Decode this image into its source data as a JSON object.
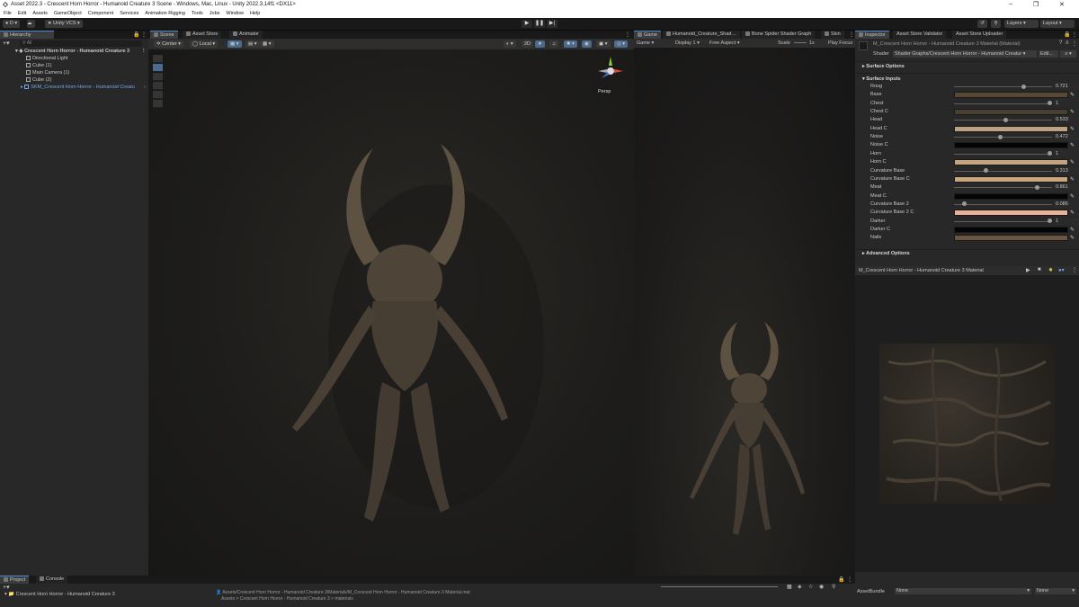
{
  "window": {
    "title": "Asset 2022.3 - Crescent Horn Horror - Humanoid Creature 3 Scene - Windows, Mac, Linux - Unity 2022.3.14f1 <DX11>"
  },
  "menu": [
    "File",
    "Edit",
    "Assets",
    "GameObject",
    "Component",
    "Services",
    "Animation Rigging",
    "Tools",
    "Jobs",
    "Window",
    "Help"
  ],
  "toolbar": {
    "account": "D",
    "vcs": "Unity VCS",
    "layers": "Layers",
    "layout": "Layout"
  },
  "hierarchy": {
    "tab": "Hierarchy",
    "search_placeholder": "All",
    "scene_name": "Crescent Horn Horror - Humanoid Creature 3",
    "items": [
      "Directional Light",
      "Cube (1)",
      "Main Camera (1)",
      "Cube (2)",
      "SKM_Crescent Horn Horror - Humanoid Creatu"
    ]
  },
  "scene": {
    "tabs": [
      "Scene",
      "Asset Store",
      "Animator"
    ],
    "pivot": "Center",
    "space": "Local",
    "mode_2d": "2D",
    "persp": "Persp"
  },
  "game": {
    "tabs": [
      "Game",
      "Humanoid_Creature_Shad…",
      "Bone Spider Shader Graph",
      "Skin"
    ],
    "display_mode": "Game",
    "display": "Display 1",
    "aspect": "Free Aspect",
    "scale_label": "Scale",
    "scale_value": "1x",
    "play_focused": "Play Focus"
  },
  "inspector": {
    "tabs": [
      "Inspector",
      "Asset Store Validator",
      "Asset Store Uploader"
    ],
    "material_name": "M_Crescent Horn Horror - Humanoid Creature 3 Material (Material)",
    "shader_label": "Shader",
    "shader_value": "Shader Graphs/Crescent Horn Horror - Humanoid Creatur",
    "edit_label": "Edit...",
    "surface_options": "Surface Options",
    "surface_inputs": "Surface Inputs",
    "advanced_options": "Advanced Options",
    "properties": [
      {
        "name": "Roug",
        "type": "slider",
        "value": "0.721",
        "fraction": 0.721
      },
      {
        "name": "Base",
        "type": "color",
        "color": "#5a4836"
      },
      {
        "name": "Chest",
        "type": "slider",
        "value": "1",
        "fraction": 1.0
      },
      {
        "name": "Chest C",
        "type": "color",
        "color": "#4a3f30"
      },
      {
        "name": "Head",
        "type": "slider",
        "value": "0.533",
        "fraction": 0.533
      },
      {
        "name": "Head C",
        "type": "color",
        "color": "#bca283"
      },
      {
        "name": "Noise",
        "type": "slider",
        "value": "0.472",
        "fraction": 0.472
      },
      {
        "name": "Noise C",
        "type": "color",
        "color": "#050505"
      },
      {
        "name": "Horn",
        "type": "slider",
        "value": "1",
        "fraction": 1.0
      },
      {
        "name": "Horn C",
        "type": "color",
        "color": "#c4a47f"
      },
      {
        "name": "Curvature Base",
        "type": "slider",
        "value": "0.313",
        "fraction": 0.313
      },
      {
        "name": "Curvature Base C",
        "type": "color",
        "color": "#c9a57b"
      },
      {
        "name": "Meat",
        "type": "slider",
        "value": "0.861",
        "fraction": 0.861
      },
      {
        "name": "Meat C",
        "type": "color",
        "color": "#050505"
      },
      {
        "name": "Curvature Base 2",
        "type": "slider",
        "value": "0.086",
        "fraction": 0.086
      },
      {
        "name": "Curvature Base 2 C",
        "type": "color",
        "color": "#e8b29a"
      },
      {
        "name": "Darker",
        "type": "slider",
        "value": "1",
        "fraction": 1.0
      },
      {
        "name": "Darker C",
        "type": "color",
        "color": "#050505"
      },
      {
        "name": "Nails",
        "type": "color",
        "color": "#6b5440"
      }
    ],
    "preview_title": "M_Crescent Horn Horror - Humanoid Creature 3 Material",
    "assetbundle_label": "AssetBundle",
    "assetbundle_value": "None",
    "assetbundle_variant": "None"
  },
  "bottom": {
    "tabs": [
      "Project",
      "Console"
    ],
    "folder": "Crescent Horn Horror - Humanoid Creature 3",
    "path": "Assets/Crescent Horn Horror - Humanoid Creature 3/Materials/M_Crescent Horn Horror - Humanoid Creature 3 Material.mat",
    "breadcrumb": "Assets > Crescent Horn Horror - Humanoid Creature 3 > materials"
  }
}
